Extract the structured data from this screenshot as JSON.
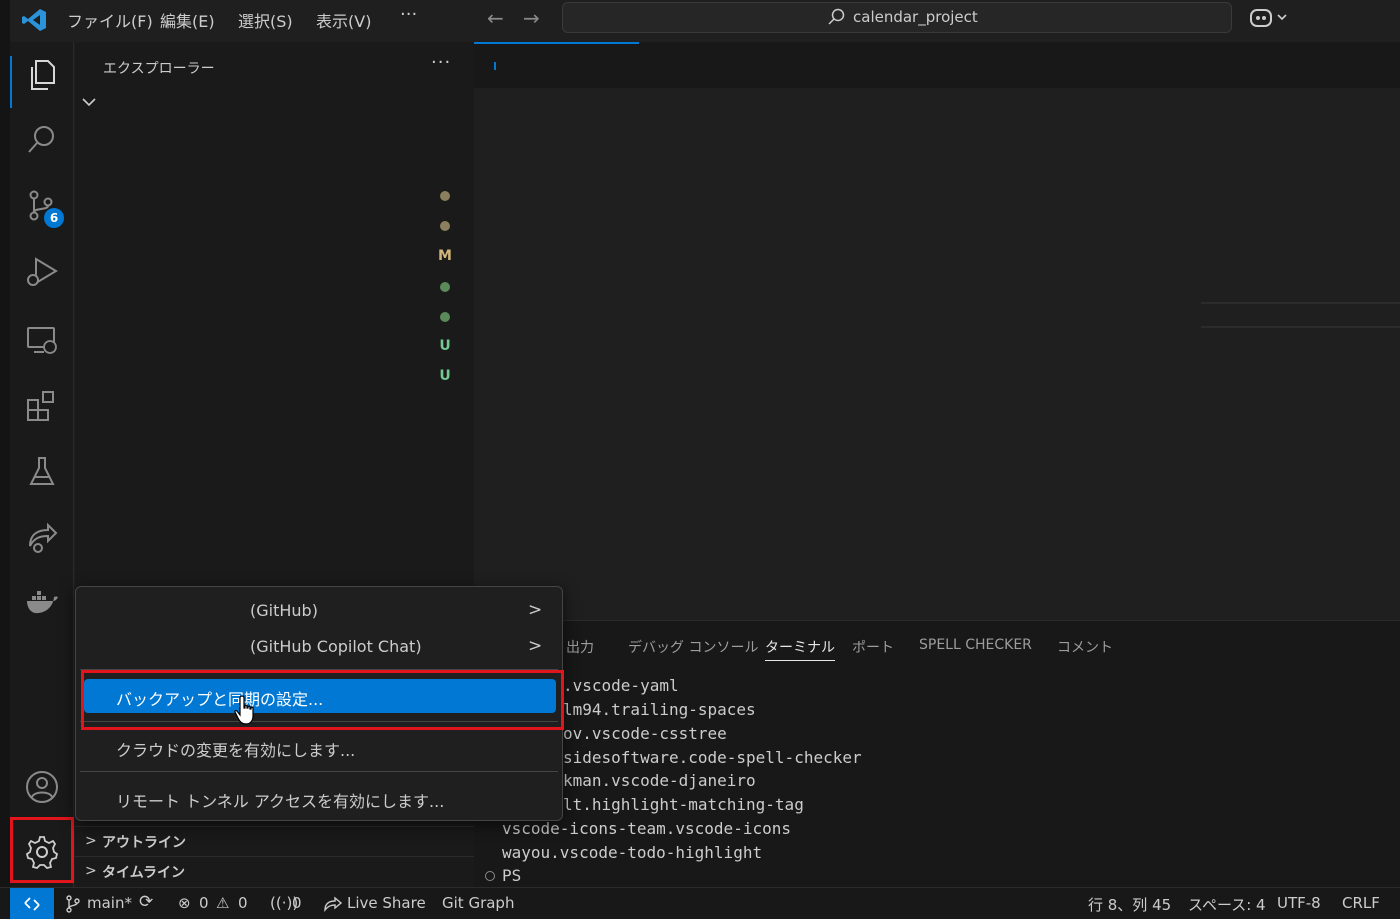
{
  "titlebar": {
    "menus": [
      "ファイル(F)",
      "編集(E)",
      "選択(S)",
      "表示(V)"
    ],
    "more": "···",
    "search_text": "calendar_project"
  },
  "activity_bar": {
    "scm_badge": "6"
  },
  "sidebar": {
    "title": "エクスプローラー",
    "more": "···",
    "git_decorations": [
      {
        "type": "dot",
        "color": "#8c7f5d"
      },
      {
        "type": "dot",
        "color": "#8c7f5d"
      },
      {
        "type": "text",
        "text": "M",
        "color": "#d1b57a"
      },
      {
        "type": "dot",
        "color": "#5b8a5a"
      },
      {
        "type": "dot",
        "color": "#5b8a5a"
      },
      {
        "type": "text",
        "text": "U",
        "color": "#73c991"
      },
      {
        "type": "text",
        "text": "U",
        "color": "#73c991"
      }
    ],
    "sections": [
      {
        "chevron": ">",
        "label": "アウトライン"
      },
      {
        "chevron": ">",
        "label": "タイムライン"
      }
    ]
  },
  "panel": {
    "tabs": [
      "出力",
      "デバッグ コンソール",
      "ターミナル",
      "ポート",
      "SPELL CHECKER",
      "コメント"
    ],
    "active_tab": "ターミナル",
    "terminal_lines": [
      ".vscode-yaml",
      "lm94.trailing-spaces",
      "ov.vscode-csstree",
      "sidesoftware.code-spell-checker",
      "kman.vscode-djaneiro",
      "lt.highlight-matching-tag",
      "vscode-icons-team.vscode-icons",
      "wayou.vscode-todo-highlight",
      "PS"
    ]
  },
  "context_menu": {
    "items": [
      {
        "label": "(GitHub)",
        "submenu": true
      },
      {
        "label": "(GitHub Copilot Chat)",
        "submenu": true
      },
      {
        "label": "バックアップと同期の設定...",
        "selected": true
      },
      {
        "label": "クラウドの変更を有効にします..."
      },
      {
        "label": "リモート トンネル アクセスを有効にします..."
      }
    ],
    "submenu_arrow": ">"
  },
  "statusbar": {
    "branch": "main*",
    "errors": "0",
    "warnings": "0",
    "ports": "0",
    "live_share": "Live Share",
    "git_graph": "Git Graph",
    "position": "行 8、列 45",
    "spaces": "スペース: 4",
    "encoding": "UTF-8",
    "eol": "CRLF"
  },
  "colors": {
    "accent": "#0078d4",
    "highlight_box": "#e0161c"
  }
}
